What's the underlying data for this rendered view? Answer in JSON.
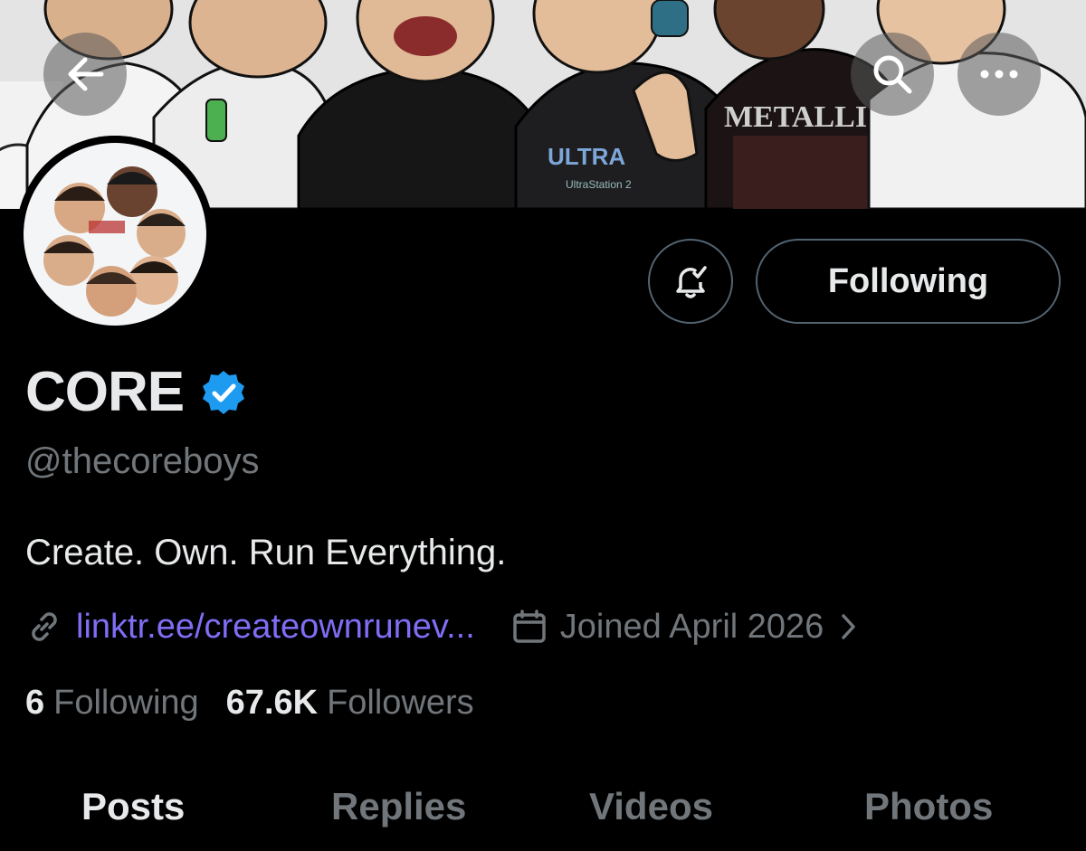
{
  "header": {
    "back_icon": "arrow-left-icon",
    "search_icon": "search-icon",
    "more_icon": "more-horizontal-icon",
    "banner_shirt_text_1": "ULTRA",
    "banner_shirt_text_2": "UltraStation 2",
    "banner_shirt_text_3": "METALLICA"
  },
  "profile": {
    "display_name": "CORE",
    "verified_icon": "verified-badge-icon",
    "verified_color": "#1d9bf0",
    "handle": "@thecoreboys",
    "bio": "Create. Own. Run Everything.",
    "link_icon": "link-icon",
    "link_text": "linktr.ee/createownrunev...",
    "link_color": "#7f6ef5",
    "calendar_icon": "calendar-icon",
    "joined_text": "Joined April 2026",
    "chevron_icon": "chevron-right-icon"
  },
  "actions": {
    "notification_icon": "bell-check-icon",
    "following_label": "Following"
  },
  "stats": {
    "following_count": "6",
    "following_label": "Following",
    "followers_count": "67.6K",
    "followers_label": "Followers"
  },
  "tabs": [
    {
      "label": "Posts",
      "active": true
    },
    {
      "label": "Replies",
      "active": false
    },
    {
      "label": "Videos",
      "active": false
    },
    {
      "label": "Photos",
      "active": false
    }
  ]
}
